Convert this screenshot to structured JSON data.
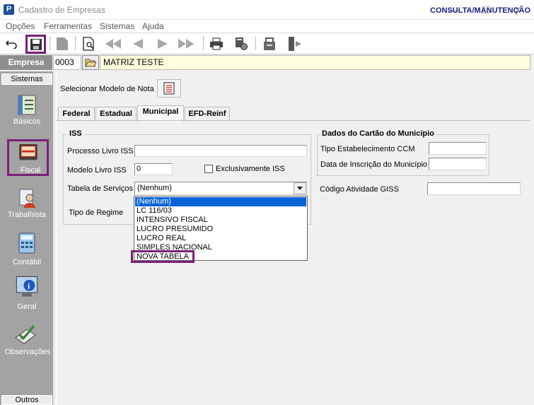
{
  "window": {
    "title": "Cadastro de Empresas",
    "app_icon_letter": "P",
    "minimize_glyph": "—",
    "maximize_glyph": "☐",
    "close_glyph": "✕"
  },
  "menu": [
    "Opções",
    "Ferramentas",
    "Sistemas",
    "Ajuda"
  ],
  "toolbar": {
    "mode_label": "CONSULTA/MANUTENÇÃO",
    "icons": [
      "undo-icon",
      "save-icon",
      "new-document-icon",
      "print-preview-icon",
      "first-record-icon",
      "previous-record-icon",
      "next-record-icon",
      "last-record-icon",
      "printer-icon",
      "config-icon",
      "save-settings-icon",
      "exit-icon"
    ]
  },
  "empresa": {
    "label": "Empresa",
    "code": "0003",
    "name": "MATRIZ TESTE"
  },
  "sidebar": {
    "header": "Sistemas",
    "footer": "Outros",
    "items": [
      {
        "label": "Básicos"
      },
      {
        "label": "Fiscal"
      },
      {
        "label": "Trabalhista"
      },
      {
        "label": "Contábil"
      },
      {
        "label": "Geral"
      },
      {
        "label": "Observações"
      }
    ]
  },
  "main": {
    "modelo_label": "Selecionar Modelo de Nota",
    "tabs": [
      {
        "label": "Federal"
      },
      {
        "label": "Estadual"
      },
      {
        "label": "Municipal"
      },
      {
        "label": "EFD-Reinf"
      }
    ],
    "active_tab": "Municipal",
    "iss": {
      "title": "ISS",
      "processo_livro_label": "Processo Livro ISS",
      "processo_livro_value": "",
      "modelo_livro_label": "Modelo Livro ISS",
      "modelo_livro_value": "0",
      "exclusivamente_label": "Exclusivamente ISS",
      "exclusivamente_checked": false,
      "tabela_label": "Tabela de Serviços",
      "tabela_value": "(Nenhum)",
      "tipo_regime_label": "Tipo de Regime",
      "dropdown_options": [
        "(Nenhum)",
        "LC 116/03",
        "INTENSIVO FISCAL",
        "LUCRO PRESUMIDO",
        "LUCRO REAL",
        "SIMPLES NACIONAL",
        "NOVA TABELA"
      ],
      "selected_option": "(Nenhum)"
    },
    "cartao": {
      "title": "Dados do Cartão do Município",
      "tipo_estab_label": "Tipo Estabelecimento CCM",
      "tipo_estab_value": "",
      "data_inscricao_label": "Data de Inscrição do Município",
      "data_inscricao_value": ""
    },
    "giss_label": "Código Atividade GISS",
    "giss_value": ""
  },
  "colors": {
    "highlight": "#7b1f7b",
    "sidebar_bg": "#a3a3a3",
    "empresa_name_bg": "#ffffe0",
    "mode_label": "#1a237e",
    "selection": "#0a64d7"
  }
}
